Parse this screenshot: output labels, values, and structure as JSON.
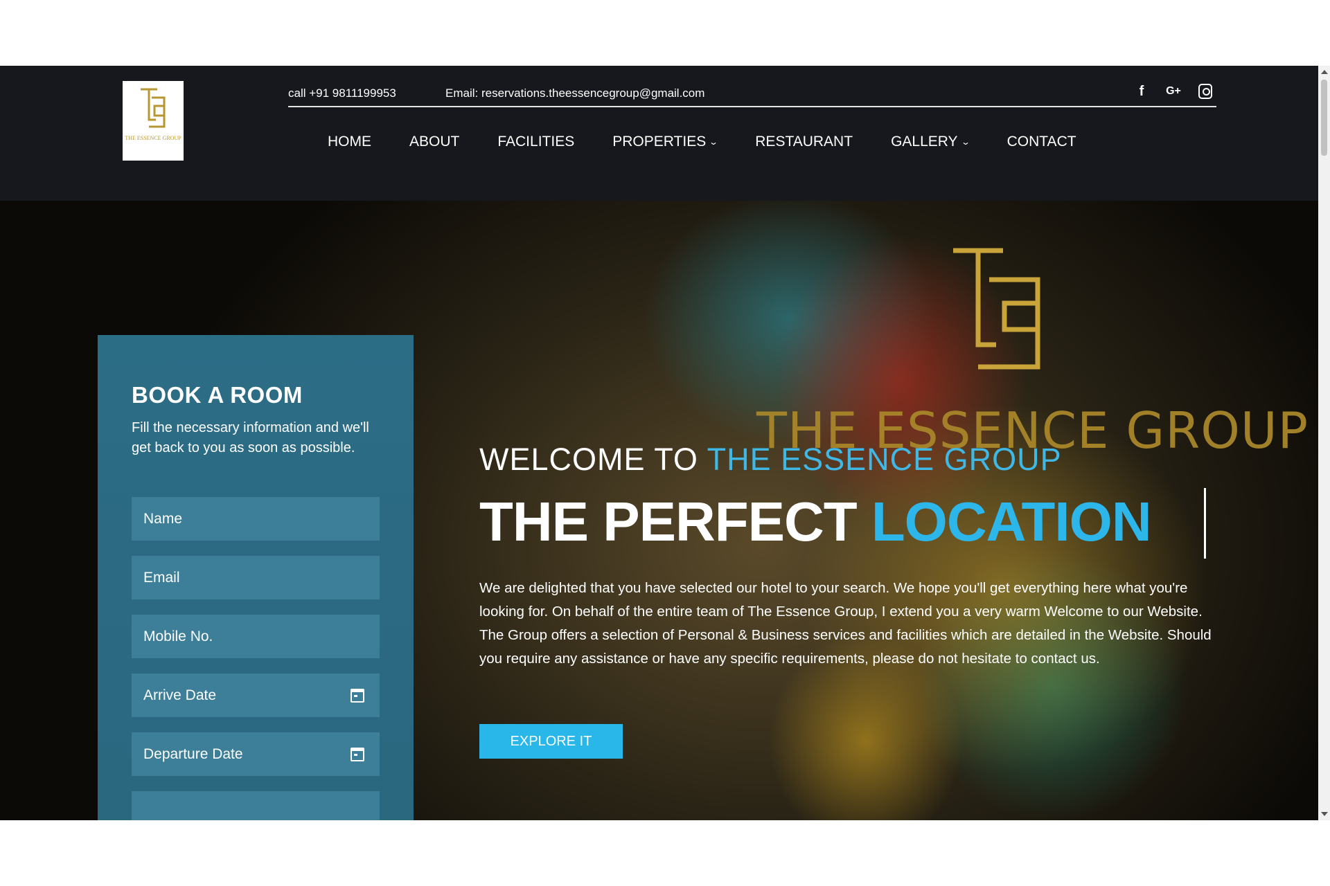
{
  "header": {
    "logo_text": "THE ESSENCE GROUP",
    "phone": "call +91 9811199953",
    "email": "Email: reservations.theessencegroup@gmail.com",
    "social": [
      {
        "name": "facebook-icon",
        "glyph": "f"
      },
      {
        "name": "google-plus-icon",
        "glyph": "G+"
      },
      {
        "name": "instagram-icon",
        "glyph": ""
      }
    ]
  },
  "nav": {
    "items": [
      {
        "label": "HOME",
        "dropdown": false
      },
      {
        "label": "ABOUT",
        "dropdown": false
      },
      {
        "label": "FACILITIES",
        "dropdown": false
      },
      {
        "label": "PROPERTIES",
        "dropdown": true
      },
      {
        "label": "RESTAURANT",
        "dropdown": false
      },
      {
        "label": "GALLERY",
        "dropdown": true
      },
      {
        "label": "CONTACT",
        "dropdown": false
      }
    ]
  },
  "hero": {
    "brand_overlay": "THE ESSENCE GROUP",
    "welcome_prefix": "WELCOME TO ",
    "welcome_highlight": "THE ESSENCE GROUP",
    "tagline_prefix": "THE PERFECT ",
    "tagline_highlight": "LOCATION",
    "intro": "We are delighted that you have selected our hotel to your search. We hope you'll get everything here what you're looking for. On behalf of the entire team of The Essence Group, I extend you a very warm Welcome to our Website. The Group offers a selection of Personal & Business services and facilities which are detailed in the Website. Should you require any assistance or have any specific requirements, please do not hesitate to contact us.",
    "cta": "EXPLORE IT"
  },
  "booking": {
    "title": "BOOK A ROOM",
    "description": "Fill the necessary information and we'll get back to you as soon as possible.",
    "fields": {
      "name": "Name",
      "email": "Email",
      "mobile": "Mobile No.",
      "arrive": "Arrive Date",
      "departure": "Departure Date"
    }
  },
  "colors": {
    "header_bg": "#17181d",
    "accent": "#29b6e8",
    "booking_bg": "#2b6a82",
    "gold": "#b8962f"
  }
}
